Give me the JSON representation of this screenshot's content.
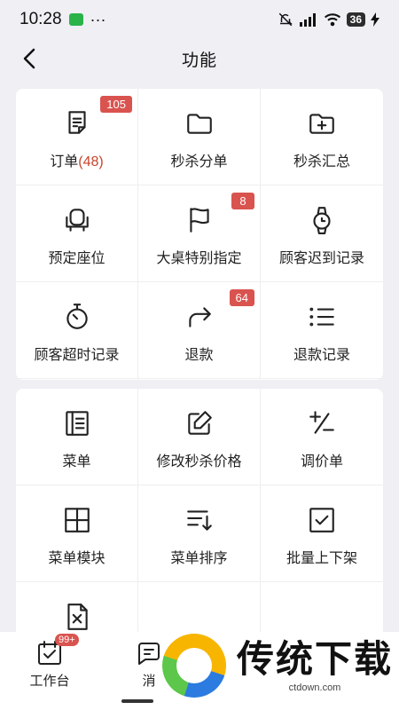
{
  "status_bar": {
    "time": "10:28",
    "dots": "···",
    "battery": "36"
  },
  "nav": {
    "title": "功能"
  },
  "card1": [
    {
      "label": "订单",
      "count": "(48)",
      "badge": "105",
      "icon": "order-doc-icon"
    },
    {
      "label": "秒杀分单",
      "icon": "folder-icon"
    },
    {
      "label": "秒杀汇总",
      "icon": "folder-plus-icon"
    },
    {
      "label": "预定座位",
      "icon": "seat-icon"
    },
    {
      "label": "大桌特别指定",
      "badge": "8",
      "icon": "flag-icon"
    },
    {
      "label": "顾客迟到记录",
      "icon": "watch-icon"
    },
    {
      "label": "顾客超时记录",
      "icon": "stopwatch-icon"
    },
    {
      "label": "退款",
      "badge": "64",
      "icon": "redo-arrow-icon"
    },
    {
      "label": "退款记录",
      "icon": "list-icon"
    }
  ],
  "card2": [
    {
      "label": "菜单",
      "icon": "menu-book-icon"
    },
    {
      "label": "修改秒杀价格",
      "icon": "edit-icon"
    },
    {
      "label": "调价单",
      "icon": "plus-minus-icon"
    },
    {
      "label": "菜单模块",
      "icon": "grid-icon"
    },
    {
      "label": "菜单排序",
      "icon": "sort-icon"
    },
    {
      "label": "批量上下架",
      "icon": "checkbox-icon"
    },
    {
      "label": "",
      "icon": "file-x-icon"
    },
    {
      "label": "",
      "icon": ""
    },
    {
      "label": "",
      "icon": ""
    }
  ],
  "tabbar": [
    {
      "label": "工作台",
      "badge": "99+",
      "icon": "workbench-icon"
    },
    {
      "label": "消",
      "icon": "message-icon"
    }
  ],
  "watermark": {
    "text": "传统下载",
    "url": "ctdown.com"
  }
}
